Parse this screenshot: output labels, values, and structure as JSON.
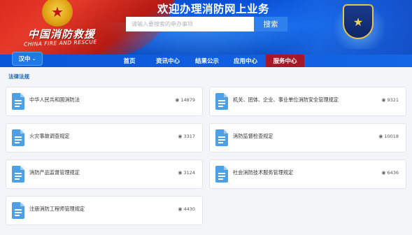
{
  "header": {
    "welcome": "欢迎办理消防网上业务",
    "brand_cn": "中国消防救援",
    "brand_en": "CHINA FIRE AND RESCUE",
    "search_placeholder": "请输入要搜索的申办事项",
    "search_button": "搜索",
    "city": "汉中"
  },
  "nav": {
    "items": [
      {
        "label": "首页",
        "active": false
      },
      {
        "label": "资讯中心",
        "active": false
      },
      {
        "label": "结果公示",
        "active": false
      },
      {
        "label": "应用中心",
        "active": false
      },
      {
        "label": "服务中心",
        "active": true
      }
    ]
  },
  "section": {
    "title": "法律法规",
    "docs": [
      {
        "title": "中华人民共和国消防法",
        "views": "14879"
      },
      {
        "title": "机关、团体、企业、事业单位消防安全管理规定",
        "views": "9321"
      },
      {
        "title": "火灾事故调查规定",
        "views": "3317"
      },
      {
        "title": "消防监督检查规定",
        "views": "10018"
      },
      {
        "title": "消防产品监督管理规定",
        "views": "3124"
      },
      {
        "title": "社会消防技术服务管理规定",
        "views": "6436"
      },
      {
        "title": "注册消防工程师管理规定",
        "views": "4430"
      }
    ]
  },
  "colors": {
    "primary": "#1466e6",
    "active_nav": "#a5182a",
    "section_title": "#0b63c7",
    "doc_icon": "#4da0e6"
  },
  "icons": [
    "fire-emblem-icon",
    "police-badge-icon",
    "chevron-down-icon",
    "document-icon",
    "eye-icon"
  ]
}
